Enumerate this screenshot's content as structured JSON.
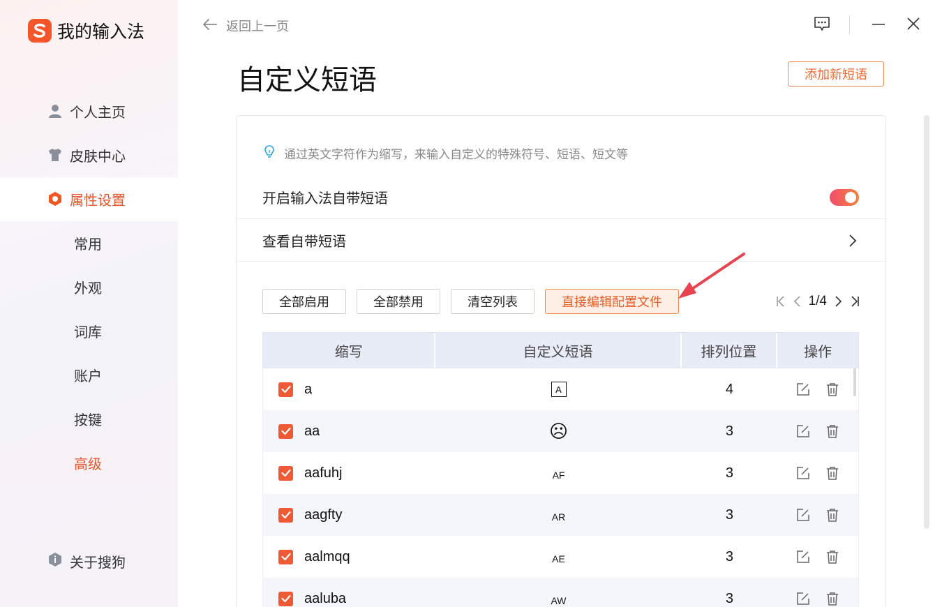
{
  "app": {
    "title": "我的输入法"
  },
  "sidebar": {
    "items": [
      {
        "label": "个人主页",
        "icon": "user-icon"
      },
      {
        "label": "皮肤中心",
        "icon": "shirt-icon"
      },
      {
        "label": "属性设置",
        "icon": "hexagon-settings-icon",
        "active": true
      }
    ],
    "subitems": [
      {
        "label": "常用"
      },
      {
        "label": "外观"
      },
      {
        "label": "词库"
      },
      {
        "label": "账户"
      },
      {
        "label": "按键"
      },
      {
        "label": "高级",
        "active": true
      }
    ],
    "about": {
      "label": "关于搜狗",
      "icon": "info-icon"
    }
  },
  "topbar": {
    "back_label": "返回上一页"
  },
  "page": {
    "title": "自定义短语",
    "add_button": "添加新短语",
    "tip": "通过英文字符作为缩写，来输入自定义的特殊符号、短语、短文等",
    "toggle_label": "开启输入法自带短语",
    "toggle_on": true,
    "view_label": "查看自带短语"
  },
  "toolbar": {
    "enable_all": "全部启用",
    "disable_all": "全部禁用",
    "clear_list": "清空列表",
    "edit_config": "直接编辑配置文件"
  },
  "pager": {
    "text": "1/4"
  },
  "table": {
    "headers": [
      "缩写",
      "自定义短语",
      "排列位置",
      "操作"
    ],
    "rows": [
      {
        "abbr": "a",
        "phrase": "🄰",
        "phrase_type": "boxed",
        "pos": "4",
        "checked": true
      },
      {
        "abbr": "aa",
        "phrase": "☹",
        "phrase_type": "face",
        "pos": "3",
        "checked": true
      },
      {
        "abbr": "aafuhj",
        "phrase": "AF",
        "phrase_type": "text",
        "pos": "3",
        "checked": true
      },
      {
        "abbr": "aagfty",
        "phrase": "AR",
        "phrase_type": "text",
        "pos": "3",
        "checked": true
      },
      {
        "abbr": "aalmqq",
        "phrase": "AE",
        "phrase_type": "text",
        "pos": "3",
        "checked": true
      },
      {
        "abbr": "aaluba",
        "phrase": "AW",
        "phrase_type": "text",
        "pos": "3",
        "checked": true
      }
    ]
  },
  "colors": {
    "accent": "#ef5a34",
    "header_bg": "#e7ecf7"
  }
}
